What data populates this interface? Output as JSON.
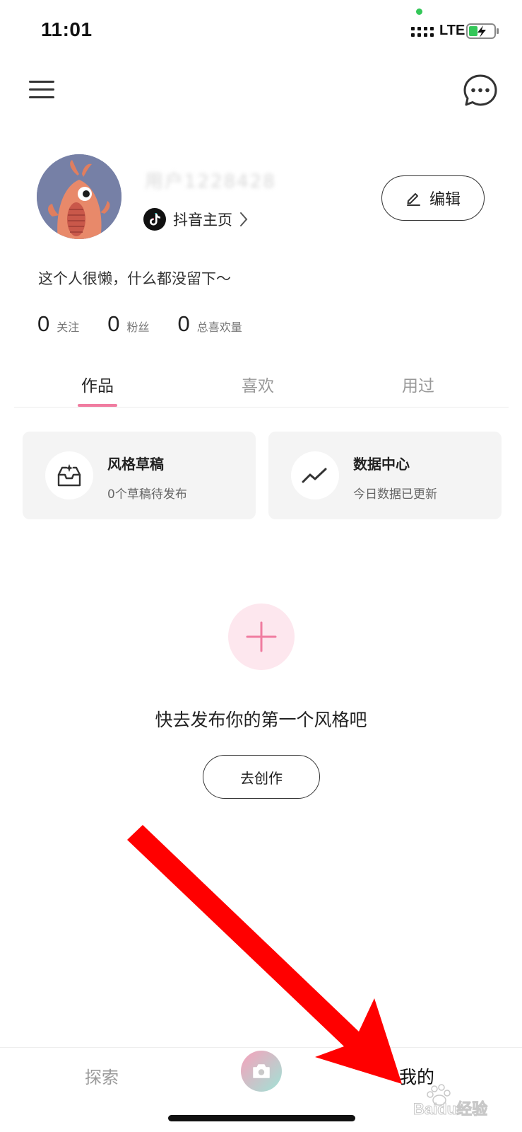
{
  "status_bar": {
    "time": "11:01",
    "network": "LTE"
  },
  "profile": {
    "username": "用户1228428",
    "douyin_link": "抖音主页",
    "edit_label": "编辑",
    "bio": "这个人很懒，什么都没留下～",
    "stats": [
      {
        "value": "0",
        "label": "关注"
      },
      {
        "value": "0",
        "label": "粉丝"
      },
      {
        "value": "0",
        "label": "总喜欢量"
      }
    ]
  },
  "tabs": [
    {
      "label": "作品",
      "active": true
    },
    {
      "label": "喜欢",
      "active": false
    },
    {
      "label": "用过",
      "active": false
    }
  ],
  "cards": [
    {
      "title": "风格草稿",
      "subtitle": "0个草稿待发布",
      "icon": "inbox-sparkle-icon"
    },
    {
      "title": "数据中心",
      "subtitle": "今日数据已更新",
      "icon": "trend-line-icon"
    }
  ],
  "empty_state": {
    "text": "快去发布你的第一个风格吧",
    "button": "去创作"
  },
  "bottom_nav": {
    "explore": "探索",
    "mine": "我的"
  },
  "watermark": "Baidu经验",
  "colors": {
    "accent_pink": "#f07ca0",
    "annotation_red": "#ff0000"
  }
}
